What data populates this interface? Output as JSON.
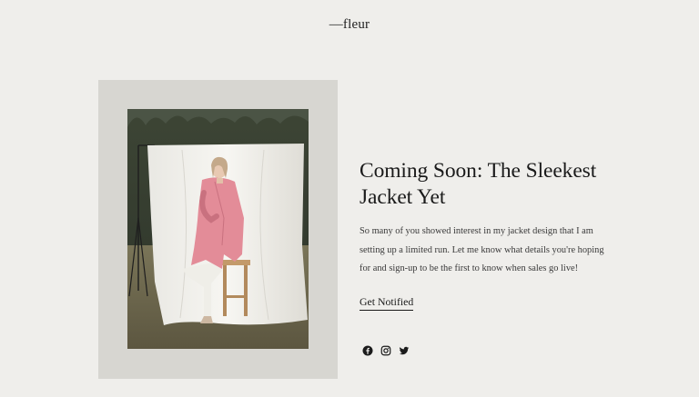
{
  "header": {
    "logo_text": "—fleur"
  },
  "hero": {
    "title": "Coming Soon: The Sleekest Jacket Yet",
    "body": "So many of you showed interest in my jacket design that I am setting up a limited run. Let me know what details you're hoping for and sign-up to be the first to know when sales go live!",
    "cta_label": "Get Notified"
  },
  "social": {
    "icons": [
      "facebook-icon",
      "instagram-icon",
      "twitter-icon"
    ]
  },
  "colors": {
    "background": "#efeeeb",
    "panel": "#d7d6d1",
    "text": "#1b1b1b",
    "jacket": "#e38c98"
  }
}
